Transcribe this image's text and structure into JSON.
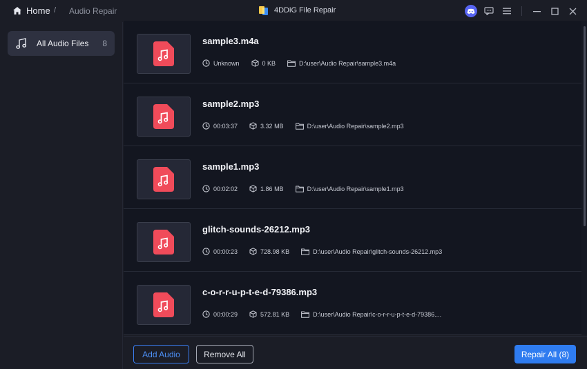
{
  "titlebar": {
    "home_label": "Home",
    "separator": "/",
    "current": "Audio Repair",
    "app_title": "4DDiG File Repair"
  },
  "sidebar": {
    "items": [
      {
        "label": "All Audio Files",
        "count": "8",
        "icon": "music-note-icon"
      }
    ]
  },
  "files": [
    {
      "name": "sample3.m4a",
      "duration": "Unknown",
      "size": "0 KB",
      "path": "D:\\user\\Audio Repair\\sample3.m4a"
    },
    {
      "name": "sample2.mp3",
      "duration": "00:03:37",
      "size": "3.32 MB",
      "path": "D:\\user\\Audio Repair\\sample2.mp3"
    },
    {
      "name": "sample1.mp3",
      "duration": "00:02:02",
      "size": "1.86 MB",
      "path": "D:\\user\\Audio Repair\\sample1.mp3"
    },
    {
      "name": "glitch-sounds-26212.mp3",
      "duration": "00:00:23",
      "size": "728.98 KB",
      "path": "D:\\user\\Audio Repair\\glitch-sounds-26212.mp3"
    },
    {
      "name": "c-o-r-r-u-p-t-e-d-79386.mp3",
      "duration": "00:00:29",
      "size": "572.81 KB",
      "path": "D:\\user\\Audio Repair\\c-o-r-r-u-p-t-e-d-79386...."
    }
  ],
  "footer": {
    "add_label": "Add Audio",
    "remove_label": "Remove All",
    "repair_label": "Repair All (8)"
  },
  "colors": {
    "accent": "#2f7cf0",
    "audio_icon": "#f04b5a",
    "discord": "#5865f2"
  }
}
